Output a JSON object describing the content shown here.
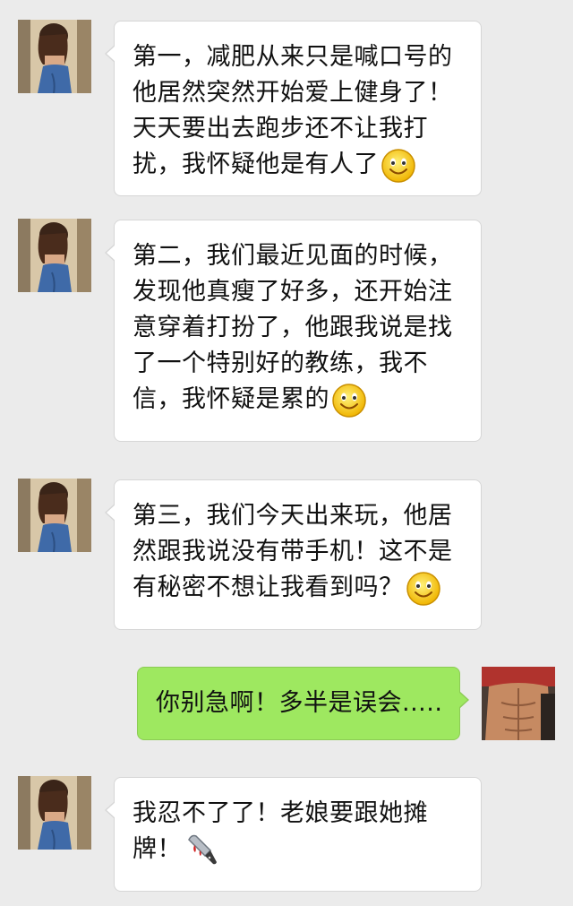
{
  "chat": {
    "messages": [
      {
        "sender": "contact",
        "lines": [
          "第一，减肥从来只是喊口号的",
          "他居然突然开始爱上健身了！",
          "天天要出去跑步还不让我打",
          "扰，我怀疑他是有人了"
        ],
        "emoji": "smile-emoji-icon"
      },
      {
        "sender": "contact",
        "lines": [
          "第二，我们最近见面的时候，",
          "发现他真瘦了好多，还开始注",
          "意穿着打扮了，他跟我说是找",
          "了一个特别好的教练，我不",
          "信，我怀疑是累的"
        ],
        "emoji": "smile-emoji-icon"
      },
      {
        "sender": "contact",
        "lines": [
          "第三，我们今天出来玩，他居",
          "然跟我说没有带手机！这不是",
          "有秘密不想让我看到吗？"
        ],
        "emoji": "smile-emoji-icon"
      },
      {
        "sender": "me",
        "lines": [
          "你别急啊！多半是误会....."
        ]
      },
      {
        "sender": "contact",
        "lines": [
          "我忍不了了！老娘要跟她摊",
          "牌！"
        ],
        "emoji": "kitchen-knife-emoji-icon"
      }
    ]
  },
  "colors": {
    "background": "#ebebeb",
    "incoming_bubble": "#ffffff",
    "outgoing_bubble": "#9ee860"
  }
}
